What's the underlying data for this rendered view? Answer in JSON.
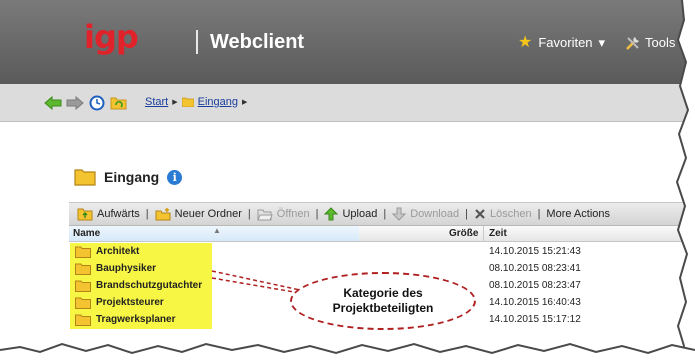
{
  "header": {
    "logo_text": "igp",
    "app_title": "Webclient",
    "favorites_label": "Favoriten",
    "tools_label": "Tools"
  },
  "nav": {
    "icons": [
      "back-arrow-icon",
      "forward-arrow-icon",
      "history-clock-icon",
      "refresh-folder-icon"
    ],
    "breadcrumb": [
      {
        "label": "Start"
      },
      {
        "label": "Eingang"
      }
    ]
  },
  "folder": {
    "title": "Eingang"
  },
  "toolbar": {
    "up_label": "Aufwärts",
    "new_folder_label": "Neuer Ordner",
    "open_label": "Öffnen",
    "upload_label": "Upload",
    "download_label": "Download",
    "delete_label": "Löschen",
    "more_label": "More Actions"
  },
  "table": {
    "columns": {
      "name": "Name",
      "size": "Größe",
      "time": "Zeit"
    },
    "rows": [
      {
        "name": "Architekt",
        "time": "14.10.2015 15:21:43"
      },
      {
        "name": "Bauphysiker",
        "time": "08.10.2015 08:23:41"
      },
      {
        "name": "Brandschutzgutachter",
        "time": "08.10.2015 08:23:47"
      },
      {
        "name": "Projektsteurer",
        "time": "14.10.2015 16:40:43"
      },
      {
        "name": "Tragwerksplaner",
        "time": "14.10.2015 15:17:12"
      }
    ]
  },
  "annotation": {
    "line1": "Kategorie des",
    "line2": "Projektbeteiligten"
  },
  "colors": {
    "header_bg": "#666666",
    "logo_red": "#e0232a",
    "highlight_yellow": "#f7f53a",
    "callout_border": "#b02020",
    "link_blue": "#1a3e9c"
  }
}
